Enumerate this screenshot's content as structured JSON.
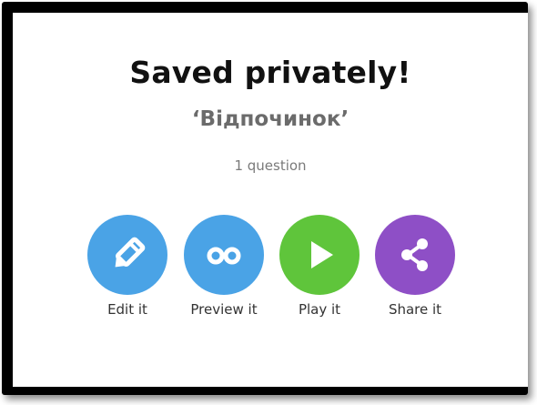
{
  "dialog": {
    "title": "Saved privately!",
    "quiz_name": "‘Відпочинок’",
    "question_count": "1 question"
  },
  "actions": [
    {
      "label": "Edit it",
      "icon": "pencil-icon",
      "color": "#4aa3e6"
    },
    {
      "label": "Preview it",
      "icon": "glasses-icon",
      "color": "#4aa3e6"
    },
    {
      "label": "Play it",
      "icon": "play-icon",
      "color": "#5fc53b"
    },
    {
      "label": "Share it",
      "icon": "share-icon",
      "color": "#8e4fc6"
    }
  ]
}
